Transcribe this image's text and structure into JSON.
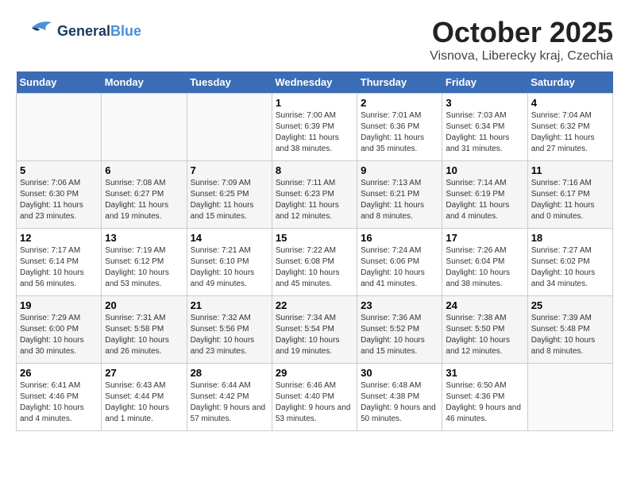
{
  "header": {
    "logo_general": "General",
    "logo_blue": "Blue",
    "month_title": "October 2025",
    "location": "Visnova, Liberecky kraj, Czechia"
  },
  "days_of_week": [
    "Sunday",
    "Monday",
    "Tuesday",
    "Wednesday",
    "Thursday",
    "Friday",
    "Saturday"
  ],
  "weeks": [
    [
      {
        "day": "",
        "info": ""
      },
      {
        "day": "",
        "info": ""
      },
      {
        "day": "",
        "info": ""
      },
      {
        "day": "1",
        "info": "Sunrise: 7:00 AM\nSunset: 6:39 PM\nDaylight: 11 hours\nand 38 minutes."
      },
      {
        "day": "2",
        "info": "Sunrise: 7:01 AM\nSunset: 6:36 PM\nDaylight: 11 hours\nand 35 minutes."
      },
      {
        "day": "3",
        "info": "Sunrise: 7:03 AM\nSunset: 6:34 PM\nDaylight: 11 hours\nand 31 minutes."
      },
      {
        "day": "4",
        "info": "Sunrise: 7:04 AM\nSunset: 6:32 PM\nDaylight: 11 hours\nand 27 minutes."
      }
    ],
    [
      {
        "day": "5",
        "info": "Sunrise: 7:06 AM\nSunset: 6:30 PM\nDaylight: 11 hours\nand 23 minutes."
      },
      {
        "day": "6",
        "info": "Sunrise: 7:08 AM\nSunset: 6:27 PM\nDaylight: 11 hours\nand 19 minutes."
      },
      {
        "day": "7",
        "info": "Sunrise: 7:09 AM\nSunset: 6:25 PM\nDaylight: 11 hours\nand 15 minutes."
      },
      {
        "day": "8",
        "info": "Sunrise: 7:11 AM\nSunset: 6:23 PM\nDaylight: 11 hours\nand 12 minutes."
      },
      {
        "day": "9",
        "info": "Sunrise: 7:13 AM\nSunset: 6:21 PM\nDaylight: 11 hours\nand 8 minutes."
      },
      {
        "day": "10",
        "info": "Sunrise: 7:14 AM\nSunset: 6:19 PM\nDaylight: 11 hours\nand 4 minutes."
      },
      {
        "day": "11",
        "info": "Sunrise: 7:16 AM\nSunset: 6:17 PM\nDaylight: 11 hours\nand 0 minutes."
      }
    ],
    [
      {
        "day": "12",
        "info": "Sunrise: 7:17 AM\nSunset: 6:14 PM\nDaylight: 10 hours\nand 56 minutes."
      },
      {
        "day": "13",
        "info": "Sunrise: 7:19 AM\nSunset: 6:12 PM\nDaylight: 10 hours\nand 53 minutes."
      },
      {
        "day": "14",
        "info": "Sunrise: 7:21 AM\nSunset: 6:10 PM\nDaylight: 10 hours\nand 49 minutes."
      },
      {
        "day": "15",
        "info": "Sunrise: 7:22 AM\nSunset: 6:08 PM\nDaylight: 10 hours\nand 45 minutes."
      },
      {
        "day": "16",
        "info": "Sunrise: 7:24 AM\nSunset: 6:06 PM\nDaylight: 10 hours\nand 41 minutes."
      },
      {
        "day": "17",
        "info": "Sunrise: 7:26 AM\nSunset: 6:04 PM\nDaylight: 10 hours\nand 38 minutes."
      },
      {
        "day": "18",
        "info": "Sunrise: 7:27 AM\nSunset: 6:02 PM\nDaylight: 10 hours\nand 34 minutes."
      }
    ],
    [
      {
        "day": "19",
        "info": "Sunrise: 7:29 AM\nSunset: 6:00 PM\nDaylight: 10 hours\nand 30 minutes."
      },
      {
        "day": "20",
        "info": "Sunrise: 7:31 AM\nSunset: 5:58 PM\nDaylight: 10 hours\nand 26 minutes."
      },
      {
        "day": "21",
        "info": "Sunrise: 7:32 AM\nSunset: 5:56 PM\nDaylight: 10 hours\nand 23 minutes."
      },
      {
        "day": "22",
        "info": "Sunrise: 7:34 AM\nSunset: 5:54 PM\nDaylight: 10 hours\nand 19 minutes."
      },
      {
        "day": "23",
        "info": "Sunrise: 7:36 AM\nSunset: 5:52 PM\nDaylight: 10 hours\nand 15 minutes."
      },
      {
        "day": "24",
        "info": "Sunrise: 7:38 AM\nSunset: 5:50 PM\nDaylight: 10 hours\nand 12 minutes."
      },
      {
        "day": "25",
        "info": "Sunrise: 7:39 AM\nSunset: 5:48 PM\nDaylight: 10 hours\nand 8 minutes."
      }
    ],
    [
      {
        "day": "26",
        "info": "Sunrise: 6:41 AM\nSunset: 4:46 PM\nDaylight: 10 hours\nand 4 minutes."
      },
      {
        "day": "27",
        "info": "Sunrise: 6:43 AM\nSunset: 4:44 PM\nDaylight: 10 hours\nand 1 minute."
      },
      {
        "day": "28",
        "info": "Sunrise: 6:44 AM\nSunset: 4:42 PM\nDaylight: 9 hours\nand 57 minutes."
      },
      {
        "day": "29",
        "info": "Sunrise: 6:46 AM\nSunset: 4:40 PM\nDaylight: 9 hours\nand 53 minutes."
      },
      {
        "day": "30",
        "info": "Sunrise: 6:48 AM\nSunset: 4:38 PM\nDaylight: 9 hours\nand 50 minutes."
      },
      {
        "day": "31",
        "info": "Sunrise: 6:50 AM\nSunset: 4:36 PM\nDaylight: 9 hours\nand 46 minutes."
      },
      {
        "day": "",
        "info": ""
      }
    ]
  ]
}
